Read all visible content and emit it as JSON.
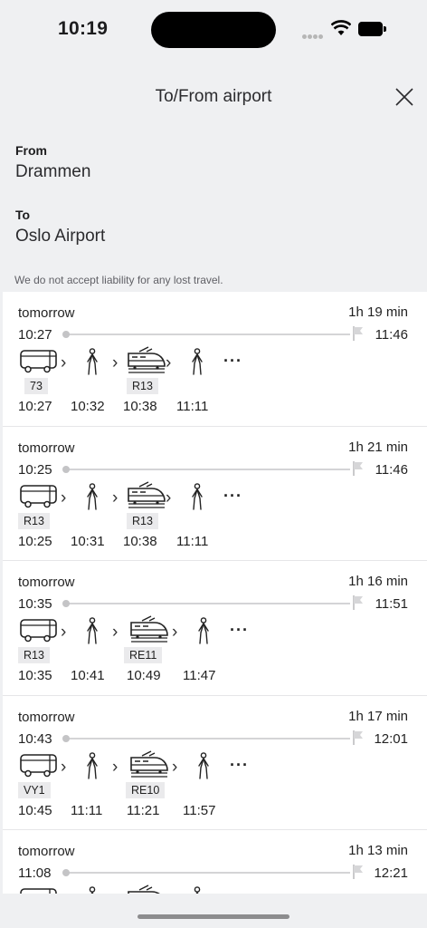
{
  "status": {
    "time": "10:19"
  },
  "header": {
    "title": "To/From airport"
  },
  "from": {
    "label": "From",
    "value": "Drammen"
  },
  "to": {
    "label": "To",
    "value": "Oslo Airport"
  },
  "disclaimer": "We do not accept liability for any lost travel.",
  "trips": [
    {
      "day": "tomorrow",
      "duration": "1h 19 min",
      "dep": "10:27",
      "arr": "11:46",
      "badges": [
        "73",
        "R13"
      ],
      "times": [
        "10:27",
        "10:32",
        "10:38",
        "11:11"
      ]
    },
    {
      "day": "tomorrow",
      "duration": "1h 21 min",
      "dep": "10:25",
      "arr": "11:46",
      "badges": [
        "R13",
        "R13"
      ],
      "times": [
        "10:25",
        "10:31",
        "10:38",
        "11:11"
      ]
    },
    {
      "day": "tomorrow",
      "duration": "1h 16 min",
      "dep": "10:35",
      "arr": "11:51",
      "badges": [
        "R13",
        "RE11"
      ],
      "times": [
        "10:35",
        "10:41",
        "10:49",
        "11:47"
      ]
    },
    {
      "day": "tomorrow",
      "duration": "1h 17 min",
      "dep": "10:43",
      "arr": "12:01",
      "badges": [
        "VY1",
        "RE10"
      ],
      "times": [
        "10:45",
        "11:11",
        "11:21",
        "11:57"
      ]
    },
    {
      "day": "tomorrow",
      "duration": "1h 13 min",
      "dep": "11:08",
      "arr": "12:21",
      "badges": [],
      "times": []
    }
  ]
}
